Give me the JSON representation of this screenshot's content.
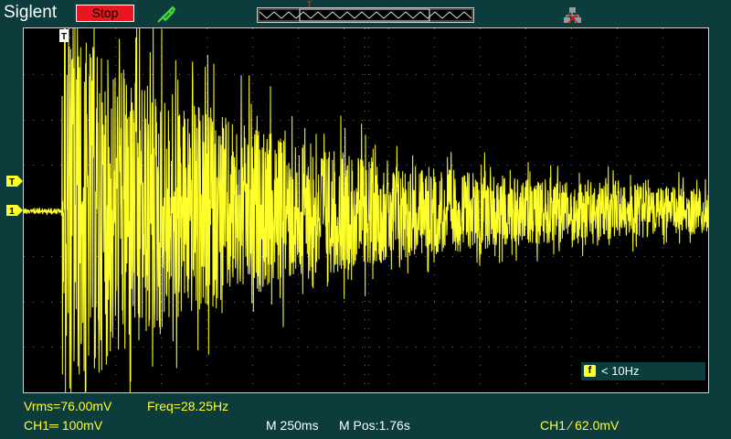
{
  "header": {
    "brand": "Siglent",
    "run_state": "Stop",
    "run_state_color": "#e8171f",
    "trigger_position_marker": "T"
  },
  "channel": {
    "trace_color": "#ffff2b",
    "ground_marker": "1",
    "trigger_level_marker": "T"
  },
  "trigger_filter": {
    "icon_label": "f",
    "text": "< 10Hz"
  },
  "measurements": {
    "vrms": "Vrms=76.00mV",
    "freq": "Freq=28.25Hz"
  },
  "status": {
    "channel_scale": "CH1═ 100mV",
    "timebase": "M 250ms",
    "position": "M Pos:1.76s",
    "trigger": "CH1 ∕ 62.0mV"
  },
  "icons": {
    "probe": "probe-icon",
    "network": "network-icon",
    "trigger_edge": "rising-edge-icon"
  }
}
